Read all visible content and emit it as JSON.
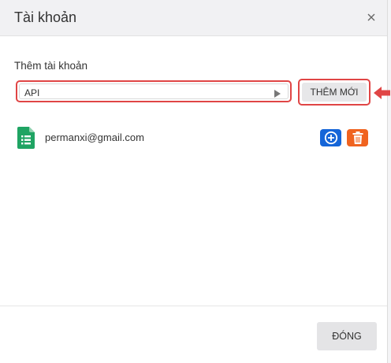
{
  "dialog": {
    "title": "Tài khoản",
    "close_icon": "close-icon"
  },
  "add_account": {
    "label": "Thêm tài khoản",
    "type_select_value": "API",
    "select_icon": "caret-right-icon",
    "add_button_label": "THÊM MỚI"
  },
  "accounts": [
    {
      "icon": "google-sheets-icon",
      "email": "permanxi@gmail.com",
      "actions": [
        {
          "icon": "plus-circle-icon",
          "color": "#1565d8"
        },
        {
          "icon": "trash-icon",
          "color": "#f0631f"
        }
      ]
    }
  ],
  "footer": {
    "close_button_label": "ĐÓNG"
  },
  "colors": {
    "highlight_annotation": "#e04545",
    "primary_blue": "#1565d8",
    "danger_orange": "#f0631f",
    "sheets_green": "#1fa463"
  }
}
